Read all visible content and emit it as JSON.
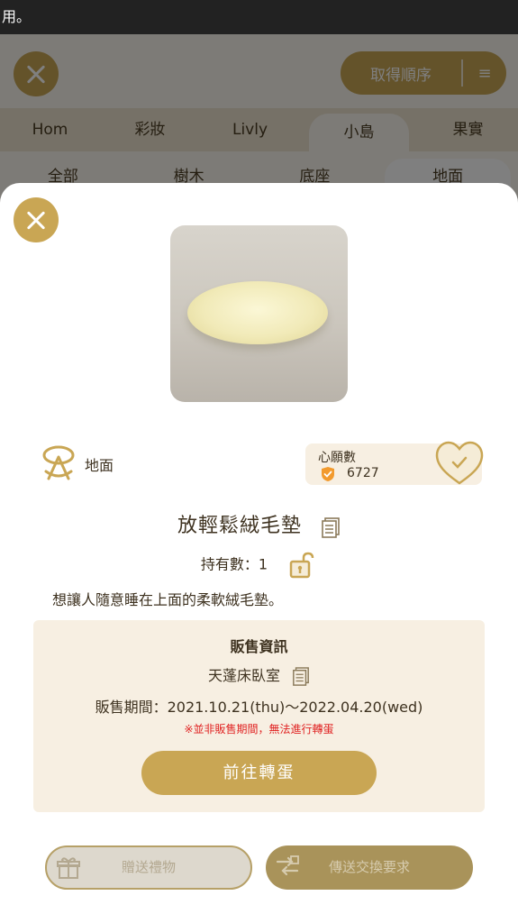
{
  "status_bar": {
    "text": "用。"
  },
  "header": {
    "sort_label": "取得順序",
    "sort_icon": "sort-icon"
  },
  "category_tabs": [
    {
      "label": "Hom",
      "active": false
    },
    {
      "label": "彩妝",
      "active": false
    },
    {
      "label": "Livly",
      "active": false
    },
    {
      "label": "小島",
      "active": true
    },
    {
      "label": "果實",
      "active": false
    }
  ],
  "sub_tabs": [
    {
      "label": "全部",
      "active": false
    },
    {
      "label": "樹木",
      "active": false
    },
    {
      "label": "底座",
      "active": false
    },
    {
      "label": "地面",
      "active": true
    }
  ],
  "modal": {
    "category": "地面",
    "wishlist": {
      "label": "心願數",
      "count": "6727"
    },
    "item_name": "放輕鬆絨毛墊",
    "owned": "持有數：1",
    "description": "想讓人隨意睡在上面的柔軟絨毛墊。",
    "sale": {
      "title": "販售資訊",
      "gacha_name": "天蓬床臥室",
      "period": "販售期間：2021.10.21(thu)～2022.04.20(wed)",
      "warning": "※並非販售期間，無法進行轉蛋",
      "go_button": "前往轉蛋"
    },
    "gift_button": "贈送禮物",
    "trade_button": "傳送交換要求"
  },
  "colors": {
    "accent": "#c9a654",
    "panel": "#f7efe2",
    "warning": "#e02222"
  }
}
